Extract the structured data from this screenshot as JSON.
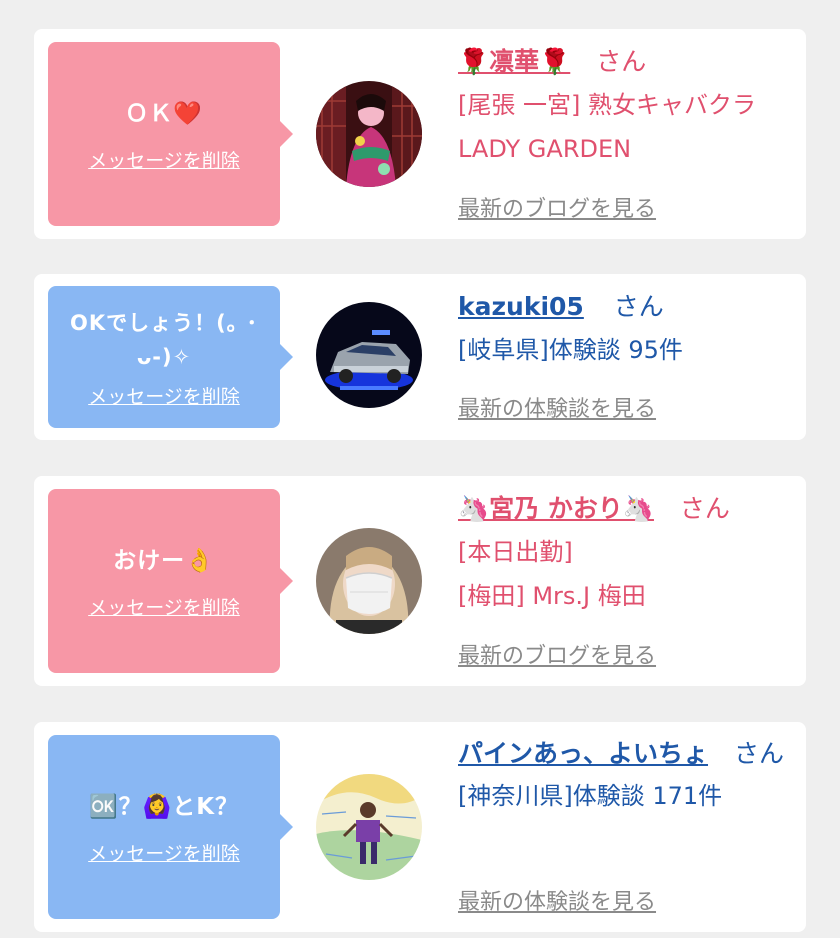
{
  "colors": {
    "pink_bubble": "#f797a6",
    "blue_bubble": "#89b7f3",
    "pink_text": "#e0506e",
    "blue_text": "#1f58a8",
    "gray_link": "#8a8a8a",
    "background": "#efefef"
  },
  "cards": [
    {
      "message": "ＯＫ❤️",
      "delete_label": "メッセージを削除",
      "name": "🌹凛華🌹",
      "honorific": "さん",
      "details": [
        "[尾張 一宮] 熟女キャバクラ LADY GARDEN"
      ],
      "more_label": "最新のブログを見る",
      "avatar_icon": "avatar-photo-woman-kimono"
    },
    {
      "message": "OKでしょう！(｡ ･ᴗ-)✧",
      "delete_label": "メッセージを削除",
      "name": "kazuki05",
      "honorific": "さん",
      "details": [
        "[岐阜県]体験談 95件"
      ],
      "more_label": "最新の体験談を見る",
      "avatar_icon": "avatar-photo-car"
    },
    {
      "message": "おけー👌",
      "delete_label": "メッセージを削除",
      "name": "🦄宮乃 かおり🦄",
      "honorific": "さん",
      "details": [
        "[本日出勤]",
        "[梅田] Mrs.J 梅田"
      ],
      "more_label": "最新のブログを見る",
      "avatar_icon": "avatar-photo-woman-mask"
    },
    {
      "message": "🆗？🙆‍♀️とK？",
      "delete_label": "メッセージを削除",
      "name": "パインあっ、よいちょ",
      "honorific": "さん",
      "details": [
        "[神奈川県]体験談 171件"
      ],
      "more_label": "最新の体験談を見る",
      "avatar_icon": "avatar-drawing-person"
    }
  ]
}
